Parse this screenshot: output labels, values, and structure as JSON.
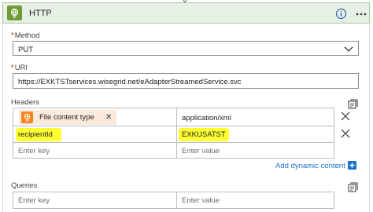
{
  "header": {
    "title": "HTTP",
    "accent_color": "#709b38",
    "info_icon": "info-icon",
    "more_icon": "more-options-icon"
  },
  "method": {
    "label": "Method",
    "required_mark": "*",
    "value": "PUT"
  },
  "uri": {
    "label": "URI",
    "required_mark": "*",
    "value": "https://EXKTSTservices.wisegrid.net/eAdapterStreamedService.svc"
  },
  "headers": {
    "label": "Headers",
    "rows": [
      {
        "key_token": "File content type",
        "value": "application/xml"
      },
      {
        "key": "recipientId",
        "value": "EXKUSATST"
      }
    ],
    "key_placeholder": "Enter key",
    "value_placeholder": "Enter value",
    "add_dynamic_content": "Add dynamic content",
    "highlight_color": "#ffff33"
  },
  "queries": {
    "label": "Queries",
    "key_placeholder": "Enter key",
    "value_placeholder": "Enter value"
  }
}
